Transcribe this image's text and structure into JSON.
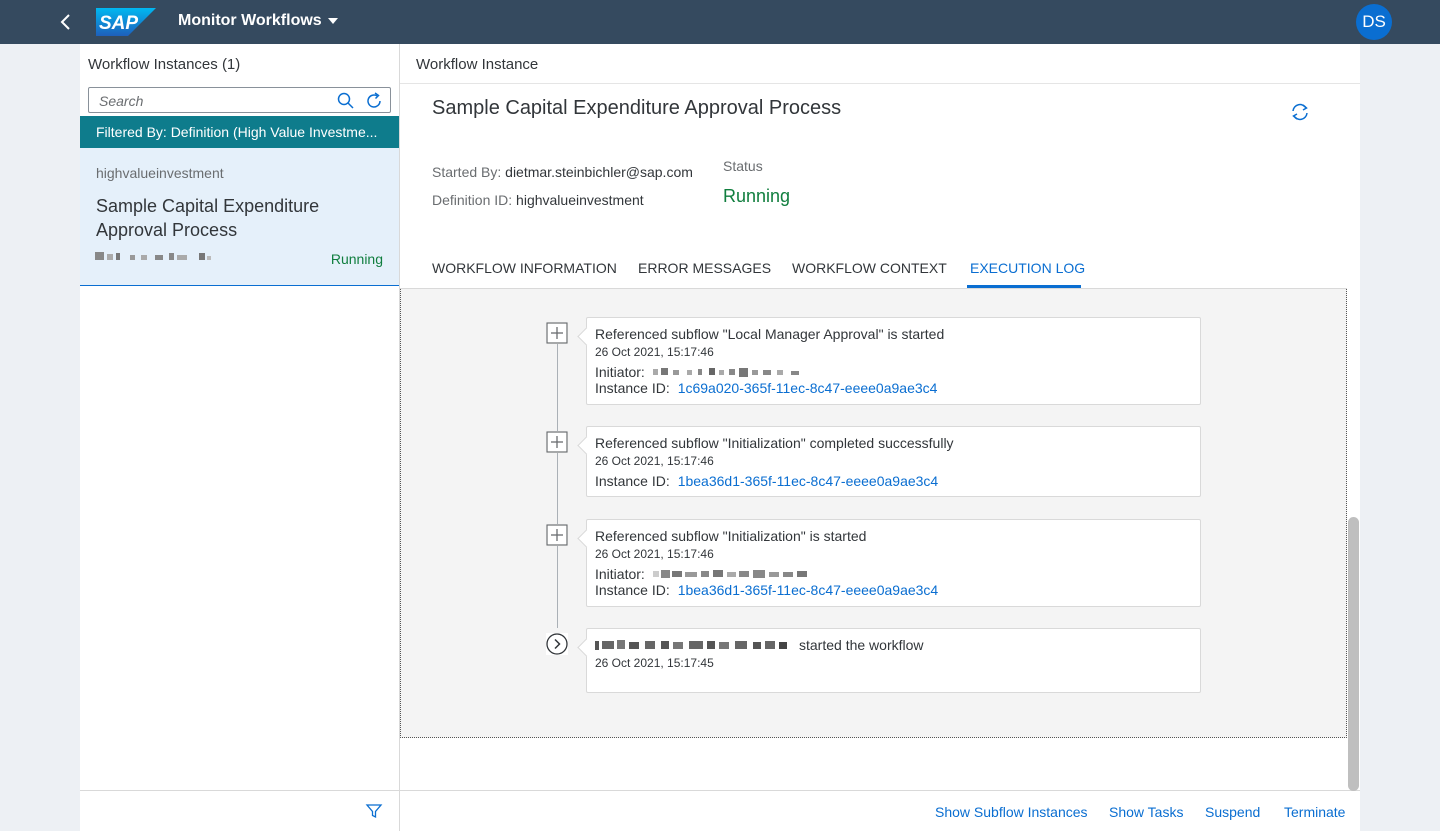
{
  "shell": {
    "app_title": "Monitor Workflows",
    "logo_text": "SAP",
    "avatar_initials": "DS",
    "colors": {
      "shell_bg": "#354a5f",
      "avatar_bg": "#0a6ed1"
    }
  },
  "master": {
    "title": "Workflow Instances (1)",
    "search_placeholder": "Search",
    "filter_text": "Filtered By: Definition (High Value Investme...",
    "items": [
      {
        "definition": "highvalueinvestment",
        "title": "Sample Capital Expenditure Approval Process",
        "status": "Running"
      }
    ]
  },
  "detail": {
    "header_title": "Workflow Instance",
    "object_title": "Sample Capital Expenditure Approval Process",
    "started_by_label": "Started By:",
    "started_by_value": "dietmar.steinbichler@sap.com",
    "definition_label": "Definition ID:",
    "definition_value": "highvalueinvestment",
    "status_label": "Status",
    "status_value": "Running",
    "tabs": [
      {
        "label": "WORKFLOW INFORMATION",
        "active": false
      },
      {
        "label": "ERROR MESSAGES",
        "active": false
      },
      {
        "label": "WORKFLOW CONTEXT",
        "active": false
      },
      {
        "label": "EXECUTION LOG",
        "active": true
      }
    ],
    "log_entries": [
      {
        "icon": "expand-icon",
        "title": "Referenced subflow \"Local Manager Approval\" is started",
        "date": "26 Oct 2021, 15:17:46",
        "initiator_label": "Initiator:",
        "instance_label": "Instance ID:",
        "instance_id": "1c69a020-365f-11ec-8c47-eeee0a9ae3c4"
      },
      {
        "icon": "expand-icon",
        "title": "Referenced subflow \"Initialization\" completed successfully",
        "date": "26 Oct 2021, 15:17:46",
        "instance_label": "Instance ID:",
        "instance_id": "1bea36d1-365f-11ec-8c47-eeee0a9ae3c4"
      },
      {
        "icon": "expand-icon",
        "title": "Referenced subflow \"Initialization\" is started",
        "date": "26 Oct 2021, 15:17:46",
        "initiator_label": "Initiator:",
        "instance_label": "Instance ID:",
        "instance_id": "1bea36d1-365f-11ec-8c47-eeee0a9ae3c4"
      },
      {
        "icon": "start-icon",
        "title": "started the workflow",
        "date": "26 Oct 2021, 15:17:45"
      }
    ],
    "footer_buttons": [
      "Show Subflow Instances",
      "Show Tasks",
      "Suspend",
      "Terminate"
    ]
  }
}
